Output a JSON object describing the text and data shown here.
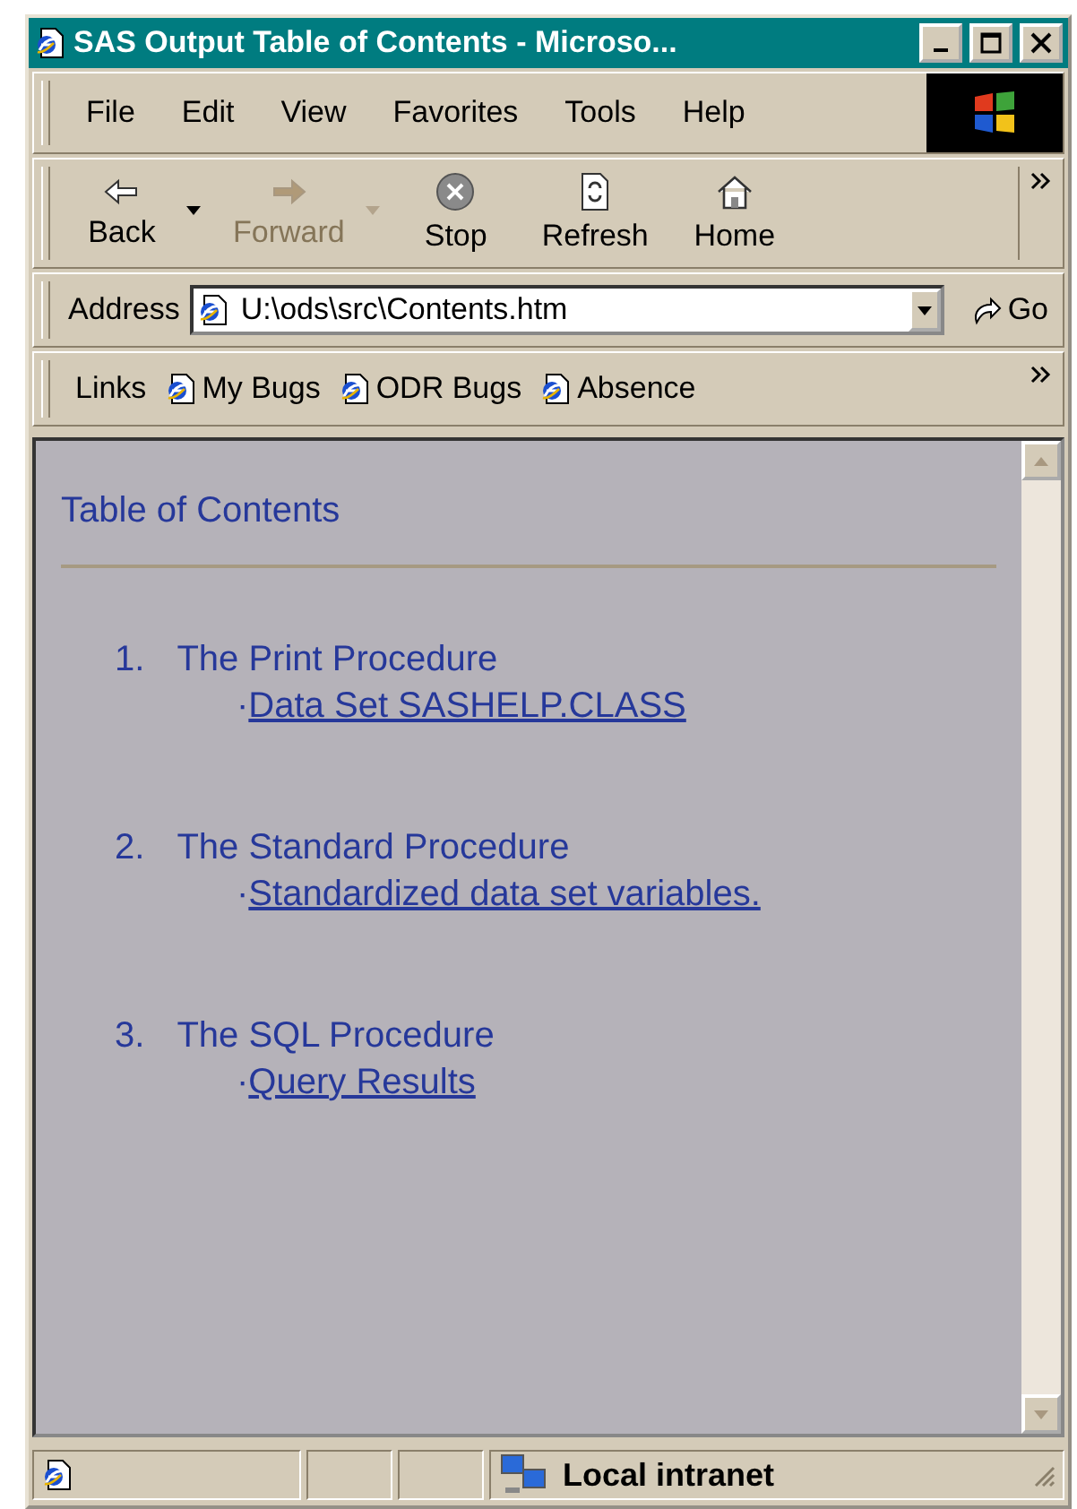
{
  "window": {
    "title": "SAS Output Table of Contents - Microso..."
  },
  "menu": [
    "File",
    "Edit",
    "View",
    "Favorites",
    "Tools",
    "Help"
  ],
  "toolbar": [
    {
      "label": "Back",
      "kind": "back",
      "disabled": false,
      "dropdown": true
    },
    {
      "label": "Forward",
      "kind": "forward",
      "disabled": true,
      "dropdown": true
    },
    {
      "label": "Stop",
      "kind": "stop",
      "disabled": false,
      "dropdown": false
    },
    {
      "label": "Refresh",
      "kind": "refresh",
      "disabled": false,
      "dropdown": false
    },
    {
      "label": "Home",
      "kind": "home",
      "disabled": false,
      "dropdown": false
    }
  ],
  "address": {
    "label": "Address",
    "value": "U:\\ods\\src\\Contents.htm",
    "go": "Go"
  },
  "links": {
    "label": "Links",
    "items": [
      "My Bugs",
      "ODR Bugs",
      "Absence"
    ]
  },
  "content": {
    "heading": "Table of Contents",
    "items": [
      {
        "number": "1.",
        "title": "The Print Procedure",
        "marker": "·",
        "link": "Data Set SASHELP.CLASS"
      },
      {
        "number": "2.",
        "title": "The Standard Procedure",
        "marker": "·",
        "link": "Standardized data set variables."
      },
      {
        "number": "3.",
        "title": "The SQL Procedure",
        "marker": "·",
        "link": "Query Results"
      }
    ]
  },
  "status_bar": {
    "zone": "Local intranet"
  }
}
